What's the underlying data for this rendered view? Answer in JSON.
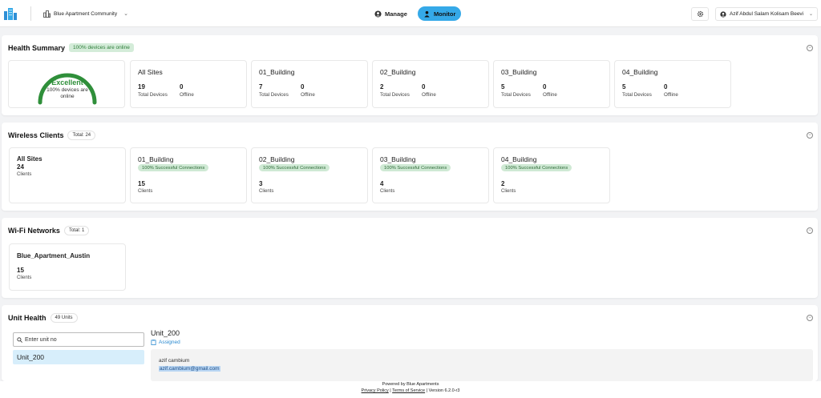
{
  "header": {
    "site_name": "Blue Apartment Community",
    "nav": [
      {
        "label": "Manage",
        "active": false
      },
      {
        "label": "Monitor",
        "active": true
      }
    ],
    "user_name": "Azif Abdul Salam Kolisam Beevi",
    "accent_color": "#35a9e8"
  },
  "health_summary": {
    "title": "Health Summary",
    "status_pill": "100% devices are online",
    "gauge": {
      "title": "Excellent",
      "subtitle": "100% devices are online",
      "percent": 100,
      "color": "#2f8f3a"
    },
    "cards": [
      {
        "name": "All Sites",
        "total": "19",
        "offline": "0"
      },
      {
        "name": "01_Building",
        "total": "7",
        "offline": "0"
      },
      {
        "name": "02_Building",
        "total": "2",
        "offline": "0"
      },
      {
        "name": "03_Building",
        "total": "5",
        "offline": "0"
      },
      {
        "name": "04_Building",
        "total": "5",
        "offline": "0"
      }
    ],
    "total_label": "Total Devices",
    "offline_label": "Offline"
  },
  "wireless_clients": {
    "title": "Wireless Clients",
    "total_pill": "Total: 24",
    "all_sites": {
      "name": "All Sites",
      "count": "24",
      "label": "Clients"
    },
    "cards": [
      {
        "name": "01_Building",
        "badge": "100% Successful Connections",
        "count": "15",
        "label": "Clients"
      },
      {
        "name": "02_Building",
        "badge": "100% Successful Connections",
        "count": "3",
        "label": "Clients"
      },
      {
        "name": "03_Building",
        "badge": "100% Successful Connections",
        "count": "4",
        "label": "Clients"
      },
      {
        "name": "04_Building",
        "badge": "100% Successful Connections",
        "count": "2",
        "label": "Clients"
      }
    ]
  },
  "wifi_networks": {
    "title": "Wi-Fi Networks",
    "total_pill": "Total: 1",
    "networks": [
      {
        "name": "Blue_Apartment_Austin",
        "count": "15",
        "label": "Clients"
      }
    ]
  },
  "unit_health": {
    "title": "Unit Health",
    "units_pill": "49 Units",
    "search_placeholder": "Enter unit no",
    "selected_unit": "Unit_200",
    "detail": {
      "unit_name": "Unit_200",
      "status": "Assigned",
      "owner_name": "azif cambium",
      "owner_email": "azif.cambium@gmail.com"
    }
  },
  "footer": {
    "powered_by": "Powered by Blue Apartments",
    "privacy": "Privacy Policy",
    "terms": "Terms of Service",
    "version": "Version 6.2.0-r3"
  }
}
